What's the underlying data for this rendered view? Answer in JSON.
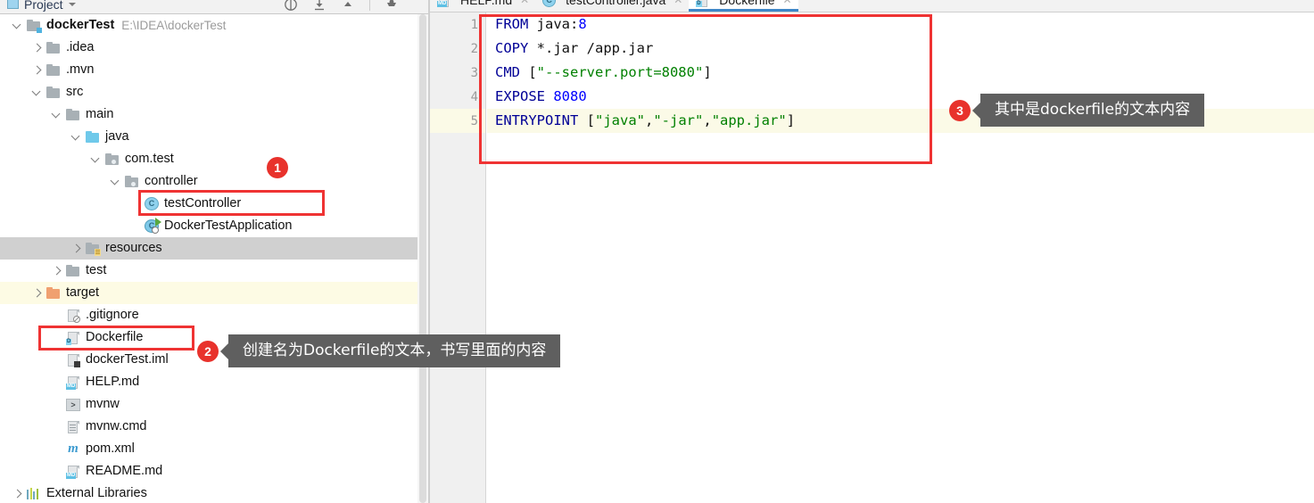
{
  "window": {
    "app": "IntelliJ IDEA",
    "colors": {
      "accent_red": "#ef3333",
      "badge_red": "#e8322c",
      "callout_bg": "#5f5f5f",
      "tab_underline": "#3e87c8",
      "keyword_blue": "#000096",
      "string_green": "#008000",
      "number_blue": "#0000ff",
      "selection_grey": "#d0d0d0",
      "highlight_yellow": "#fdfbe4"
    }
  },
  "project_panel": {
    "toolbar": {
      "title": "Project",
      "title_caret_icon": "chevron-down-icon",
      "icons": [
        "collapse-all-icon",
        "expand-all-icon",
        "scroll-up-icon",
        "settings-gear-icon"
      ]
    },
    "tree": [
      {
        "label": "dockerTest",
        "sub": "E:\\IDEA\\dockerTest",
        "indent": 0,
        "arrow": "open",
        "icon": "module-folder-icon",
        "bold": true
      },
      {
        "label": ".idea",
        "sub": "",
        "indent": 1,
        "arrow": "closed",
        "icon": "folder-icon"
      },
      {
        "label": ".mvn",
        "sub": "",
        "indent": 1,
        "arrow": "closed",
        "icon": "folder-icon"
      },
      {
        "label": "src",
        "sub": "",
        "indent": 1,
        "arrow": "open",
        "icon": "folder-icon"
      },
      {
        "label": "main",
        "sub": "",
        "indent": 2,
        "arrow": "open",
        "icon": "folder-icon"
      },
      {
        "label": "java",
        "sub": "",
        "indent": 3,
        "arrow": "open",
        "icon": "source-root-folder-icon"
      },
      {
        "label": "com.test",
        "sub": "",
        "indent": 4,
        "arrow": "open",
        "icon": "package-icon"
      },
      {
        "label": "controller",
        "sub": "",
        "indent": 5,
        "arrow": "open",
        "icon": "package-icon"
      },
      {
        "label": "testController",
        "sub": "",
        "indent": 6,
        "arrow": "none",
        "icon": "java-class-icon"
      },
      {
        "label": "DockerTestApplication",
        "sub": "",
        "indent": 6,
        "arrow": "none",
        "icon": "spring-boot-class-icon"
      },
      {
        "label": "resources",
        "sub": "",
        "indent": 3,
        "arrow": "closed",
        "icon": "resources-folder-icon",
        "state": "selected"
      },
      {
        "label": "test",
        "sub": "",
        "indent": 2,
        "arrow": "closed",
        "icon": "folder-icon"
      },
      {
        "label": "target",
        "sub": "",
        "indent": 1,
        "arrow": "closed",
        "icon": "excluded-folder-icon",
        "state": "highlighted"
      },
      {
        "label": ".gitignore",
        "sub": "",
        "indent": 2,
        "arrow": "none",
        "icon": "gitignore-file-icon"
      },
      {
        "label": "Dockerfile",
        "sub": "",
        "indent": 2,
        "arrow": "none",
        "icon": "dockerfile-icon"
      },
      {
        "label": "dockerTest.iml",
        "sub": "",
        "indent": 2,
        "arrow": "none",
        "icon": "iml-file-icon"
      },
      {
        "label": "HELP.md",
        "sub": "",
        "indent": 2,
        "arrow": "none",
        "icon": "markdown-file-icon"
      },
      {
        "label": "mvnw",
        "sub": "",
        "indent": 2,
        "arrow": "none",
        "icon": "shell-script-icon"
      },
      {
        "label": "mvnw.cmd",
        "sub": "",
        "indent": 2,
        "arrow": "none",
        "icon": "text-file-icon"
      },
      {
        "label": "pom.xml",
        "sub": "",
        "indent": 2,
        "arrow": "none",
        "icon": "maven-file-icon"
      },
      {
        "label": "README.md",
        "sub": "",
        "indent": 2,
        "arrow": "none",
        "icon": "markdown-file-icon"
      },
      {
        "label": "External Libraries",
        "sub": "",
        "indent": 0,
        "arrow": "closed",
        "icon": "libraries-icon"
      }
    ]
  },
  "editor": {
    "tabs": [
      {
        "label": "HELP.md",
        "icon": "markdown-file-icon",
        "active": false,
        "close_icon": "close-icon"
      },
      {
        "label": "testController.java",
        "icon": "java-class-icon",
        "active": false,
        "close_icon": "close-icon"
      },
      {
        "label": "Dockerfile",
        "icon": "dockerfile-icon",
        "active": true,
        "close_icon": "close-icon"
      }
    ],
    "gutter": {
      "line_numbers": [
        "1",
        "2",
        "3",
        "4",
        "5"
      ],
      "run_icon": "run-double-chevron-icon",
      "run_icon_line": 1,
      "current_line": 5
    },
    "code_lines": [
      [
        {
          "t": "FROM",
          "c": "kw"
        },
        {
          "t": " java:",
          "c": "plain"
        },
        {
          "t": "8",
          "c": "num"
        }
      ],
      [
        {
          "t": "COPY",
          "c": "kw"
        },
        {
          "t": " *.jar /app.jar",
          "c": "plain"
        }
      ],
      [
        {
          "t": "CMD",
          "c": "kw"
        },
        {
          "t": " [",
          "c": "plain"
        },
        {
          "t": "\"--server.port=8080\"",
          "c": "str"
        },
        {
          "t": "]",
          "c": "plain"
        }
      ],
      [
        {
          "t": "EXPOSE",
          "c": "kw"
        },
        {
          "t": " ",
          "c": "plain"
        },
        {
          "t": "8080",
          "c": "num"
        }
      ],
      [
        {
          "t": "ENTRYPOINT",
          "c": "kw"
        },
        {
          "t": " [",
          "c": "plain"
        },
        {
          "t": "\"java\"",
          "c": "str"
        },
        {
          "t": ",",
          "c": "plain"
        },
        {
          "t": "\"-jar\"",
          "c": "str"
        },
        {
          "t": ",",
          "c": "plain"
        },
        {
          "t": "\"app.jar\"",
          "c": "str"
        },
        {
          "t": "]",
          "c": "plain"
        }
      ]
    ]
  },
  "annotations": [
    {
      "number": "1",
      "text": "",
      "target": "testController"
    },
    {
      "number": "2",
      "text": "创建名为Dockerfile的文本，书写里面的内容",
      "target": "Dockerfile"
    },
    {
      "number": "3",
      "text": "其中是dockerfile的文本内容",
      "target": "dockerfile-code"
    }
  ]
}
